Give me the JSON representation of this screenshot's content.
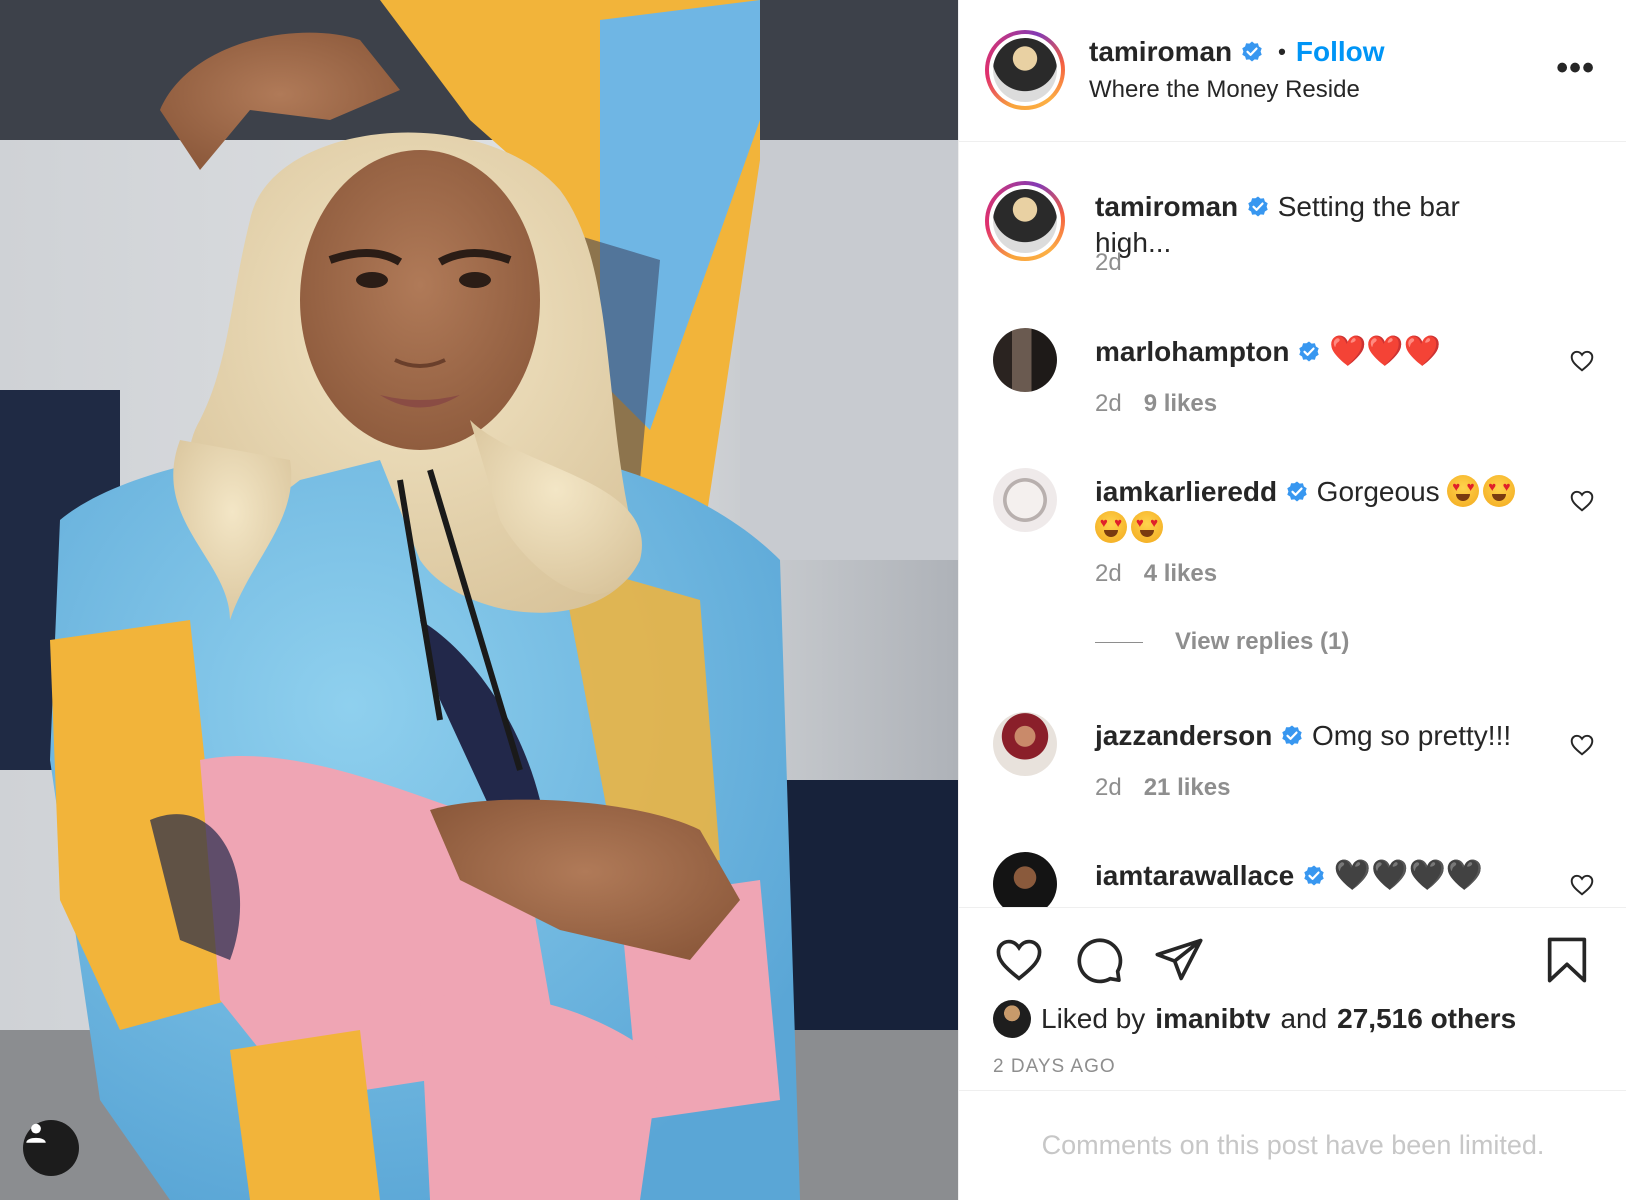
{
  "post": {
    "username": "tamiroman",
    "follow_label": "Follow",
    "separator": "•",
    "location": "Where the Money Reside",
    "more_label": "•••"
  },
  "caption": {
    "username": "tamiroman",
    "text": "Setting the bar high...",
    "time": "2d"
  },
  "comments": [
    {
      "username": "marlohampton",
      "text": "❤️❤️❤️",
      "kind": "red-hearts",
      "count": 3,
      "time": "2d",
      "likes": "9 likes"
    },
    {
      "username": "iamkarlieredd",
      "text": "Gorgeous",
      "kind": "heart-eyes",
      "count": 4,
      "time": "2d",
      "likes": "4 likes",
      "view_replies": "View replies (1)"
    },
    {
      "username": "jazzanderson",
      "text": "Omg so pretty!!!",
      "time": "2d",
      "likes": "21 likes"
    },
    {
      "username": "iamtarawallace",
      "text": "🖤🖤🖤🖤",
      "kind": "black-hearts",
      "count": 4
    }
  ],
  "likes": {
    "prefix": "Liked by",
    "user": "imanibtv",
    "connector": "and",
    "others": "27,516 others"
  },
  "timestamp": "2 DAYS AGO",
  "comments_limited": "Comments on this post have been limited.",
  "colors": {
    "accent": "#0095f6",
    "verified": "#3897f0",
    "muted": "#8e8e8e",
    "text": "#262626"
  },
  "icons": [
    "user-tag-icon",
    "verified-badge-icon",
    "more-options-icon",
    "heart-icon",
    "comment-icon",
    "share-icon",
    "bookmark-icon"
  ]
}
